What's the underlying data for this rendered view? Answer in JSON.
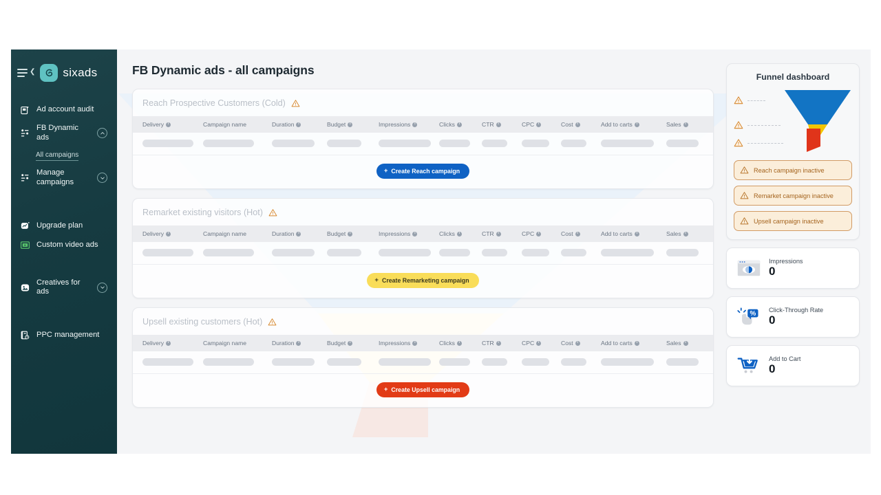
{
  "brand": {
    "name": "sixads",
    "logo_icon": "sixads-logo-icon",
    "menu_icon": "hamburger-collapse-icon"
  },
  "sidebar": {
    "items": [
      {
        "label": "Ad account audit",
        "icon": "ad-account-audit-icon",
        "expandable": false
      },
      {
        "label": "FB Dynamic ads",
        "icon": "dynamic-ads-icon",
        "expandable": true,
        "chevron": "chevron-up-icon"
      },
      {
        "label": "Manage campaigns",
        "icon": "manage-campaigns-icon",
        "expandable": true,
        "chevron": "chevron-down-icon"
      },
      {
        "label": "Upgrade plan",
        "icon": "upgrade-plan-icon",
        "expandable": false
      },
      {
        "label": "Custom video ads",
        "icon": "video-ads-icon",
        "expandable": false
      },
      {
        "label": "Creatives for ads",
        "icon": "creatives-icon",
        "expandable": true,
        "chevron": "chevron-down-icon"
      },
      {
        "label": "PPC management",
        "icon": "ppc-management-icon",
        "expandable": false
      }
    ],
    "subitem": {
      "label": "All campaigns"
    }
  },
  "header": {
    "title": "FB Dynamic ads - all campaigns"
  },
  "table": {
    "columns": [
      {
        "label": "Delivery",
        "info": true
      },
      {
        "label": "Campaign name",
        "info": false
      },
      {
        "label": "Duration",
        "info": true
      },
      {
        "label": "Budget",
        "info": true
      },
      {
        "label": "Impressions",
        "info": true
      },
      {
        "label": "Clicks",
        "info": true
      },
      {
        "label": "CTR",
        "info": true
      },
      {
        "label": "CPC",
        "info": true
      },
      {
        "label": "Cost",
        "info": true
      },
      {
        "label": "Add to carts",
        "info": true
      },
      {
        "label": "Sales",
        "info": true
      }
    ]
  },
  "cards": [
    {
      "title": "Reach Prospective Customers (Cold)",
      "warning_icon": "warning-triangle-icon",
      "cta_label": "Create Reach campaign",
      "cta_plus": "+",
      "cta_color": "#0f62c4",
      "tint": "#e9f1fa"
    },
    {
      "title": "Remarket existing visitors (Hot)",
      "warning_icon": "warning-triangle-icon",
      "cta_label": "Create Remarketing campaign",
      "cta_plus": "+",
      "cta_color": "#f9dd59",
      "tint": "#fdf6dd"
    },
    {
      "title": "Upsell existing customers (Hot)",
      "warning_icon": "warning-triangle-icon",
      "cta_label": "Create Upsell campaign",
      "cta_plus": "+",
      "cta_color": "#e23b16",
      "tint": "#f7e7e3"
    }
  ],
  "funnel": {
    "title": "Funnel dashboard",
    "segments": [
      {
        "name": "reach",
        "color": "#1274c4"
      },
      {
        "name": "remarket",
        "color": "#f2c500"
      },
      {
        "name": "upsell",
        "color": "#e0341a"
      }
    ],
    "legend_icons": [
      "warning-triangle-icon",
      "warning-triangle-icon",
      "warning-triangle-icon"
    ],
    "alerts": [
      {
        "label": "Reach campaign inactive",
        "icon": "warning-triangle-icon"
      },
      {
        "label": "Remarket campaign inactive",
        "icon": "warning-triangle-icon"
      },
      {
        "label": "Upsell campaign inactive",
        "icon": "warning-triangle-icon"
      }
    ],
    "alert_color": "#a4631d"
  },
  "metrics": [
    {
      "label": "Impressions",
      "value": "0",
      "icon": "impressions-eye-icon"
    },
    {
      "label": "Click-Through Rate",
      "value": "0",
      "icon": "click-through-rate-icon"
    },
    {
      "label": "Add to Cart",
      "value": "0",
      "icon": "add-to-cart-icon"
    }
  ]
}
